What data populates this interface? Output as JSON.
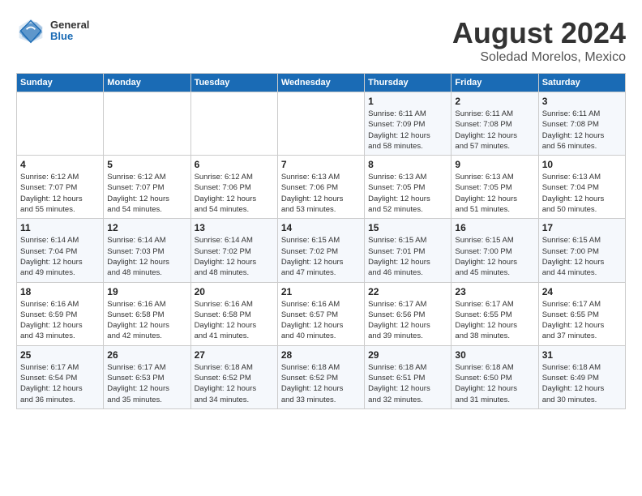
{
  "header": {
    "logo": {
      "general": "General",
      "blue": "Blue"
    },
    "month_year": "August 2024",
    "location": "Soledad Morelos, Mexico"
  },
  "calendar": {
    "days_of_week": [
      "Sunday",
      "Monday",
      "Tuesday",
      "Wednesday",
      "Thursday",
      "Friday",
      "Saturday"
    ],
    "weeks": [
      [
        {
          "day": "",
          "info": ""
        },
        {
          "day": "",
          "info": ""
        },
        {
          "day": "",
          "info": ""
        },
        {
          "day": "",
          "info": ""
        },
        {
          "day": "1",
          "info": "Sunrise: 6:11 AM\nSunset: 7:09 PM\nDaylight: 12 hours\nand 58 minutes."
        },
        {
          "day": "2",
          "info": "Sunrise: 6:11 AM\nSunset: 7:08 PM\nDaylight: 12 hours\nand 57 minutes."
        },
        {
          "day": "3",
          "info": "Sunrise: 6:11 AM\nSunset: 7:08 PM\nDaylight: 12 hours\nand 56 minutes."
        }
      ],
      [
        {
          "day": "4",
          "info": "Sunrise: 6:12 AM\nSunset: 7:07 PM\nDaylight: 12 hours\nand 55 minutes."
        },
        {
          "day": "5",
          "info": "Sunrise: 6:12 AM\nSunset: 7:07 PM\nDaylight: 12 hours\nand 54 minutes."
        },
        {
          "day": "6",
          "info": "Sunrise: 6:12 AM\nSunset: 7:06 PM\nDaylight: 12 hours\nand 54 minutes."
        },
        {
          "day": "7",
          "info": "Sunrise: 6:13 AM\nSunset: 7:06 PM\nDaylight: 12 hours\nand 53 minutes."
        },
        {
          "day": "8",
          "info": "Sunrise: 6:13 AM\nSunset: 7:05 PM\nDaylight: 12 hours\nand 52 minutes."
        },
        {
          "day": "9",
          "info": "Sunrise: 6:13 AM\nSunset: 7:05 PM\nDaylight: 12 hours\nand 51 minutes."
        },
        {
          "day": "10",
          "info": "Sunrise: 6:13 AM\nSunset: 7:04 PM\nDaylight: 12 hours\nand 50 minutes."
        }
      ],
      [
        {
          "day": "11",
          "info": "Sunrise: 6:14 AM\nSunset: 7:04 PM\nDaylight: 12 hours\nand 49 minutes."
        },
        {
          "day": "12",
          "info": "Sunrise: 6:14 AM\nSunset: 7:03 PM\nDaylight: 12 hours\nand 48 minutes."
        },
        {
          "day": "13",
          "info": "Sunrise: 6:14 AM\nSunset: 7:02 PM\nDaylight: 12 hours\nand 48 minutes."
        },
        {
          "day": "14",
          "info": "Sunrise: 6:15 AM\nSunset: 7:02 PM\nDaylight: 12 hours\nand 47 minutes."
        },
        {
          "day": "15",
          "info": "Sunrise: 6:15 AM\nSunset: 7:01 PM\nDaylight: 12 hours\nand 46 minutes."
        },
        {
          "day": "16",
          "info": "Sunrise: 6:15 AM\nSunset: 7:00 PM\nDaylight: 12 hours\nand 45 minutes."
        },
        {
          "day": "17",
          "info": "Sunrise: 6:15 AM\nSunset: 7:00 PM\nDaylight: 12 hours\nand 44 minutes."
        }
      ],
      [
        {
          "day": "18",
          "info": "Sunrise: 6:16 AM\nSunset: 6:59 PM\nDaylight: 12 hours\nand 43 minutes."
        },
        {
          "day": "19",
          "info": "Sunrise: 6:16 AM\nSunset: 6:58 PM\nDaylight: 12 hours\nand 42 minutes."
        },
        {
          "day": "20",
          "info": "Sunrise: 6:16 AM\nSunset: 6:58 PM\nDaylight: 12 hours\nand 41 minutes."
        },
        {
          "day": "21",
          "info": "Sunrise: 6:16 AM\nSunset: 6:57 PM\nDaylight: 12 hours\nand 40 minutes."
        },
        {
          "day": "22",
          "info": "Sunrise: 6:17 AM\nSunset: 6:56 PM\nDaylight: 12 hours\nand 39 minutes."
        },
        {
          "day": "23",
          "info": "Sunrise: 6:17 AM\nSunset: 6:55 PM\nDaylight: 12 hours\nand 38 minutes."
        },
        {
          "day": "24",
          "info": "Sunrise: 6:17 AM\nSunset: 6:55 PM\nDaylight: 12 hours\nand 37 minutes."
        }
      ],
      [
        {
          "day": "25",
          "info": "Sunrise: 6:17 AM\nSunset: 6:54 PM\nDaylight: 12 hours\nand 36 minutes."
        },
        {
          "day": "26",
          "info": "Sunrise: 6:17 AM\nSunset: 6:53 PM\nDaylight: 12 hours\nand 35 minutes."
        },
        {
          "day": "27",
          "info": "Sunrise: 6:18 AM\nSunset: 6:52 PM\nDaylight: 12 hours\nand 34 minutes."
        },
        {
          "day": "28",
          "info": "Sunrise: 6:18 AM\nSunset: 6:52 PM\nDaylight: 12 hours\nand 33 minutes."
        },
        {
          "day": "29",
          "info": "Sunrise: 6:18 AM\nSunset: 6:51 PM\nDaylight: 12 hours\nand 32 minutes."
        },
        {
          "day": "30",
          "info": "Sunrise: 6:18 AM\nSunset: 6:50 PM\nDaylight: 12 hours\nand 31 minutes."
        },
        {
          "day": "31",
          "info": "Sunrise: 6:18 AM\nSunset: 6:49 PM\nDaylight: 12 hours\nand 30 minutes."
        }
      ]
    ]
  }
}
